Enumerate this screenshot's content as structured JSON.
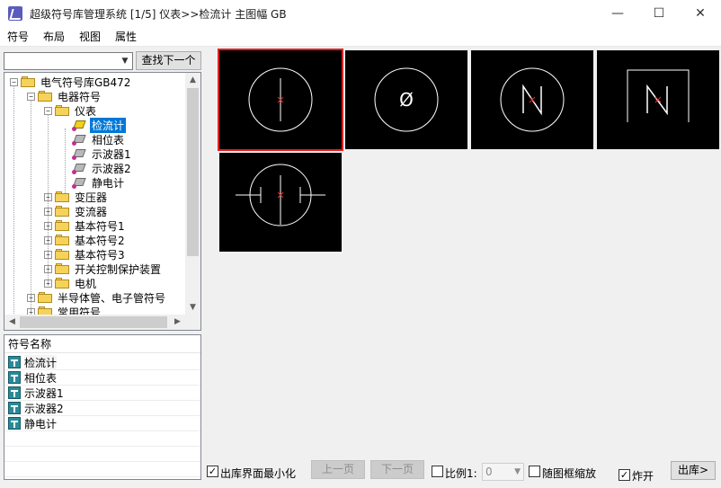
{
  "window": {
    "title": "超级符号库管理系统 [1/5] 仪表>>检流计 主图幅 GB",
    "controls": {
      "minimize": "—",
      "maximize": "☐",
      "close": "✕"
    }
  },
  "menu": [
    "符号",
    "布局",
    "视图",
    "属性"
  ],
  "search": {
    "value": "",
    "find_next": "查找下一个"
  },
  "tree": {
    "nodes": [
      {
        "label": "电气符号库GB472",
        "level": 0,
        "expander": "−"
      },
      {
        "label": "电器符号",
        "level": 1,
        "expander": "−"
      },
      {
        "label": "仪表",
        "level": 2,
        "expander": "−"
      },
      {
        "label": "检流计",
        "level": 3,
        "leaf": true,
        "selected": true
      },
      {
        "label": "相位表",
        "level": 3,
        "leaf": true
      },
      {
        "label": "示波器1",
        "level": 3,
        "leaf": true
      },
      {
        "label": "示波器2",
        "level": 3,
        "leaf": true
      },
      {
        "label": "静电计",
        "level": 3,
        "leaf": true
      },
      {
        "label": "变压器",
        "level": 2,
        "expander": "+"
      },
      {
        "label": "变流器",
        "level": 2,
        "expander": "+"
      },
      {
        "label": "基本符号1",
        "level": 2,
        "expander": "+"
      },
      {
        "label": "基本符号2",
        "level": 2,
        "expander": "+"
      },
      {
        "label": "基本符号3",
        "level": 2,
        "expander": "+"
      },
      {
        "label": "开关控制保护装置",
        "level": 2,
        "expander": "+"
      },
      {
        "label": "电机",
        "level": 2,
        "expander": "+"
      },
      {
        "label": "半导体管、电子管符号",
        "level": 1,
        "expander": "+"
      },
      {
        "label": "常用符号",
        "level": 1,
        "expander": "+"
      }
    ]
  },
  "list": {
    "header": "符号名称",
    "items": [
      "检流计",
      "相位表",
      "示波器1",
      "示波器2",
      "静电计"
    ]
  },
  "preview": {
    "tiles": [
      {
        "symbol": "galvanometer",
        "selected": true
      },
      {
        "symbol": "phase-meter",
        "mark": "Ø"
      },
      {
        "symbol": "oscilloscope-1",
        "mark": "N"
      },
      {
        "symbol": "oscilloscope-2",
        "mark": "N"
      },
      {
        "symbol": "electrometer"
      }
    ]
  },
  "bottom": {
    "minimize_on_export": {
      "label": "出库界面最小化",
      "checked": true
    },
    "prev_page": "上一页",
    "next_page": "下一页",
    "scale": {
      "label": "比例1:",
      "checked": false,
      "value": "0"
    },
    "zoom_with_frame": {
      "label": "随图框缩放",
      "checked": false
    },
    "explode": {
      "label": "炸开",
      "checked": true
    },
    "export": "出库"
  },
  "colors": {
    "selection": "#0078d7",
    "tile_bg": "#000000",
    "tile_selected_border": "#e02020",
    "symbol_stroke": "#ffffff",
    "symbol_center": "#e03030"
  }
}
